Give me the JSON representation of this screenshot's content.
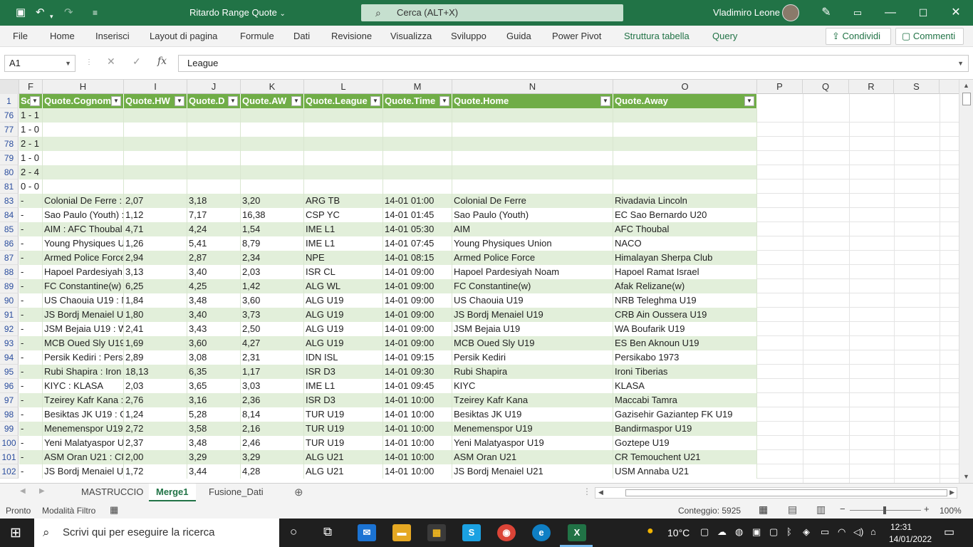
{
  "app": {
    "title": "Ritardo Range Quote",
    "title_suffix": "⌄",
    "search_placeholder": "Cerca (ALT+X)",
    "user": "Vladimiro Leone",
    "accent": "#217346"
  },
  "menu": {
    "items": [
      "File",
      "Home",
      "Inserisci",
      "Layout di pagina",
      "Formule",
      "Dati",
      "Revisione",
      "Visualizza",
      "Sviluppo",
      "Guida",
      "Power Pivot",
      "Struttura tabella",
      "Query"
    ],
    "share": "Condividi",
    "comments": "Commenti"
  },
  "formula": {
    "namebox": "A1",
    "fx": "fx",
    "value": "League"
  },
  "columns": [
    "F",
    "H",
    "I",
    "J",
    "K",
    "L",
    "M",
    "N",
    "O",
    "P",
    "Q",
    "R",
    "S"
  ],
  "table_headers": [
    "Sc",
    "Quote.Cognom",
    "Quote.HW",
    "Quote.D",
    "Quote.AW",
    "Quote.League",
    "Quote.Time",
    "Quote.Home",
    "Quote.Away"
  ],
  "rows": [
    {
      "n": "76",
      "f": "1 - 1",
      "h": "",
      "i": "",
      "j": "",
      "k": "",
      "l": "",
      "m": "",
      "home": "",
      "away": ""
    },
    {
      "n": "77",
      "f": "1 - 0",
      "h": "",
      "i": "",
      "j": "",
      "k": "",
      "l": "",
      "m": "",
      "home": "",
      "away": ""
    },
    {
      "n": "78",
      "f": "2 - 1",
      "h": "",
      "i": "",
      "j": "",
      "k": "",
      "l": "",
      "m": "",
      "home": "",
      "away": ""
    },
    {
      "n": "79",
      "f": "1 - 0",
      "h": "",
      "i": "",
      "j": "",
      "k": "",
      "l": "",
      "m": "",
      "home": "",
      "away": ""
    },
    {
      "n": "80",
      "f": "2 - 4",
      "h": "",
      "i": "",
      "j": "",
      "k": "",
      "l": "",
      "m": "",
      "home": "",
      "away": ""
    },
    {
      "n": "81",
      "f": "0 - 0",
      "h": "",
      "i": "",
      "j": "",
      "k": "",
      "l": "",
      "m": "",
      "home": "",
      "away": ""
    },
    {
      "n": "83",
      "f": "-",
      "h": "Colonial De Ferre :",
      "i": "2,07",
      "j": "3,18",
      "k": "3,20",
      "l": "ARG TB",
      "m": "14-01 01:00",
      "home": "Colonial De Ferre",
      "away": "Rivadavia Lincoln"
    },
    {
      "n": "84",
      "f": "-",
      "h": "Sao Paulo (Youth) :",
      "i": "1,12",
      "j": "7,17",
      "k": "16,38",
      "l": "CSP YC",
      "m": "14-01 01:45",
      "home": "Sao Paulo (Youth)",
      "away": "EC Sao Bernardo U20"
    },
    {
      "n": "85",
      "f": "-",
      "h": "AIM : AFC Thoubal",
      "i": "4,71",
      "j": "4,24",
      "k": "1,54",
      "l": "IME L1",
      "m": "14-01 05:30",
      "home": "AIM",
      "away": "AFC Thoubal"
    },
    {
      "n": "86",
      "f": "-",
      "h": "Young Physiques U",
      "i": "1,26",
      "j": "5,41",
      "k": "8,79",
      "l": "IME L1",
      "m": "14-01 07:45",
      "home": "Young Physiques Union",
      "away": "NACO"
    },
    {
      "n": "87",
      "f": "-",
      "h": "Armed Police Force",
      "i": "2,94",
      "j": "2,87",
      "k": "2,34",
      "l": "NPE",
      "m": "14-01 08:15",
      "home": "Armed Police Force",
      "away": "Himalayan Sherpa Club"
    },
    {
      "n": "88",
      "f": "-",
      "h": "Hapoel Pardesiyah",
      "i": "3,13",
      "j": "3,40",
      "k": "2,03",
      "l": "ISR CL",
      "m": "14-01 09:00",
      "home": "Hapoel Pardesiyah Noam",
      "away": "Hapoel Ramat Israel"
    },
    {
      "n": "89",
      "f": "-",
      "h": "FC Constantine(w)",
      "i": "6,25",
      "j": "4,25",
      "k": "1,42",
      "l": "ALG WL",
      "m": "14-01 09:00",
      "home": "FC Constantine(w)",
      "away": "Afak Relizane(w)"
    },
    {
      "n": "90",
      "f": "-",
      "h": "US Chaouia U19 : N",
      "i": "1,84",
      "j": "3,48",
      "k": "3,60",
      "l": "ALG U19",
      "m": "14-01 09:00",
      "home": "US Chaouia U19",
      "away": "NRB Teleghma U19"
    },
    {
      "n": "91",
      "f": "-",
      "h": "JS Bordj Menaiel U",
      "i": "1,80",
      "j": "3,40",
      "k": "3,73",
      "l": "ALG U19",
      "m": "14-01 09:00",
      "home": "JS Bordj Menaiel U19",
      "away": "CRB Ain Oussera U19"
    },
    {
      "n": "92",
      "f": "-",
      "h": "JSM Bejaia U19 : W",
      "i": "2,41",
      "j": "3,43",
      "k": "2,50",
      "l": "ALG U19",
      "m": "14-01 09:00",
      "home": "JSM Bejaia U19",
      "away": "WA Boufarik U19"
    },
    {
      "n": "93",
      "f": "-",
      "h": "MCB Oued Sly U19",
      "i": "1,69",
      "j": "3,60",
      "k": "4,27",
      "l": "ALG U19",
      "m": "14-01 09:00",
      "home": "MCB Oued Sly U19",
      "away": "ES Ben Aknoun U19"
    },
    {
      "n": "94",
      "f": "-",
      "h": "Persik Kediri : Pers",
      "i": "2,89",
      "j": "3,08",
      "k": "2,31",
      "l": "IDN ISL",
      "m": "14-01 09:15",
      "home": "Persik Kediri",
      "away": "Persikabo 1973"
    },
    {
      "n": "95",
      "f": "-",
      "h": "Rubi Shapira : Iron",
      "i": "18,13",
      "j": "6,35",
      "k": "1,17",
      "l": "ISR D3",
      "m": "14-01 09:30",
      "home": "Rubi Shapira",
      "away": "Ironi Tiberias"
    },
    {
      "n": "96",
      "f": "-",
      "h": "KIYC : KLASA",
      "i": "2,03",
      "j": "3,65",
      "k": "3,03",
      "l": "IME L1",
      "m": "14-01 09:45",
      "home": "KIYC",
      "away": "KLASA"
    },
    {
      "n": "97",
      "f": "-",
      "h": "Tzeirey Kafr Kana :",
      "i": "2,76",
      "j": "3,16",
      "k": "2,36",
      "l": "ISR D3",
      "m": "14-01 10:00",
      "home": "Tzeirey Kafr Kana",
      "away": "Maccabi Tamra"
    },
    {
      "n": "98",
      "f": "-",
      "h": "Besiktas JK U19 : G",
      "i": "1,24",
      "j": "5,28",
      "k": "8,14",
      "l": "TUR U19",
      "m": "14-01 10:00",
      "home": "Besiktas JK U19",
      "away": "Gazisehir Gaziantep FK U19"
    },
    {
      "n": "99",
      "f": "-",
      "h": "Menemenspor U19",
      "i": "2,72",
      "j": "3,58",
      "k": "2,16",
      "l": "TUR U19",
      "m": "14-01 10:00",
      "home": "Menemenspor U19",
      "away": "Bandirmaspor U19"
    },
    {
      "n": "100",
      "f": "-",
      "h": "Yeni Malatyaspor U",
      "i": "2,37",
      "j": "3,48",
      "k": "2,46",
      "l": "TUR U19",
      "m": "14-01 10:00",
      "home": "Yeni Malatyaspor U19",
      "away": "Goztepe U19"
    },
    {
      "n": "101",
      "f": "-",
      "h": "ASM Oran U21 : CR",
      "i": "2,00",
      "j": "3,29",
      "k": "3,29",
      "l": "ALG U21",
      "m": "14-01 10:00",
      "home": "ASM Oran U21",
      "away": "CR Temouchent U21"
    },
    {
      "n": "102",
      "f": "-",
      "h": "JS Bordj Menaiel U",
      "i": "1,72",
      "j": "3,44",
      "k": "4,28",
      "l": "ALG U21",
      "m": "14-01 10:00",
      "home": "JS Bordj Menaiel U21",
      "away": "USM Annaba U21"
    }
  ],
  "sheets": [
    "MASTRUCCIO",
    "Merge1",
    "Fusione_Dati"
  ],
  "active_sheet": "Merge1",
  "status": {
    "ready": "Pronto",
    "mode": "Modalità Filtro",
    "count": "Conteggio: 5925",
    "zoom": "100%"
  },
  "taskbar": {
    "search": "Scrivi qui per eseguire la ricerca",
    "temp": "10°C",
    "time": "12:31",
    "date": "14/01/2022"
  }
}
